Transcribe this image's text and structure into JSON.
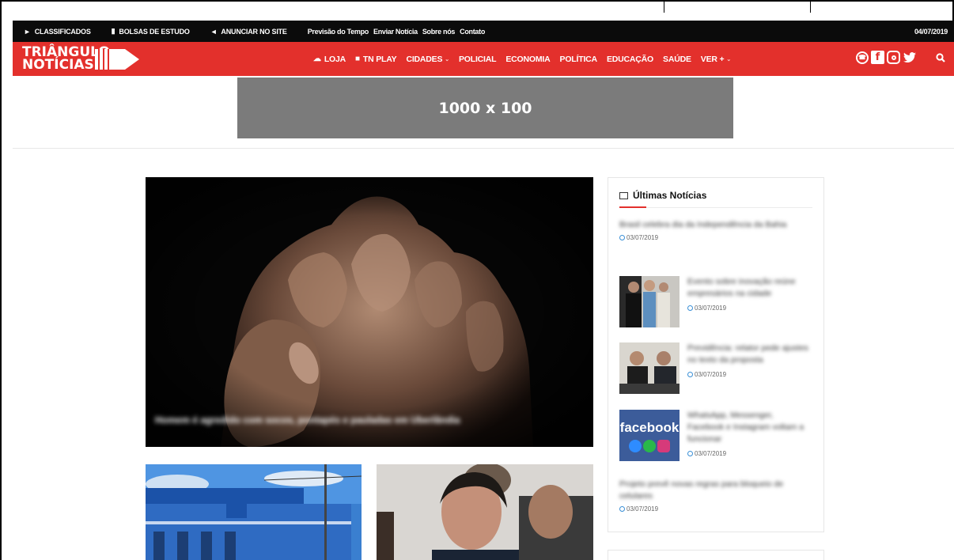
{
  "topbar": {
    "items": [
      {
        "label": "CLASSIFICADOS",
        "icon": "tag-icon"
      },
      {
        "label": "BOLSAS DE ESTUDO",
        "icon": "book-icon"
      },
      {
        "label": "ANUNCIAR NO SITE",
        "icon": "megaphone-icon"
      }
    ],
    "links": [
      "Previsão do Tempo",
      "Enviar Notícia",
      "Sobre nós",
      "Contato"
    ],
    "date": "04/07/2019"
  },
  "nav": {
    "logo_line1": "TRIÂNGULO",
    "logo_line2": "NOTÍCIAS",
    "menu": [
      {
        "label": "LOJA",
        "icon": "shop-icon"
      },
      {
        "label": "TN PLAY",
        "icon": "video-icon"
      },
      {
        "label": "CIDADES",
        "dropdown": true
      },
      {
        "label": "POLICIAL"
      },
      {
        "label": "ECONOMIA"
      },
      {
        "label": "POLÍTICA"
      },
      {
        "label": "EDUCAÇÃO"
      },
      {
        "label": "SAÚDE"
      },
      {
        "label": "VER +",
        "dropdown": true
      }
    ],
    "social": [
      "whatsapp-icon",
      "facebook-icon",
      "instagram-icon",
      "twitter-icon"
    ],
    "brand_color": "#e3302c"
  },
  "ad": {
    "label": "1000 x 100"
  },
  "hero": {
    "caption": "Homem é agredido com socos, pontapés e pauladas em Uberlândia"
  },
  "sidebar": {
    "title": "Últimas Notícias",
    "items": [
      {
        "title": "Brasil celebra dia da Independência da Bahia",
        "date": "03/07/2019"
      },
      {
        "title": "Evento sobre inovação reúne empresários na cidade",
        "date": "03/07/2019"
      },
      {
        "title": "Previdência: relator pede ajustes no texto da proposta",
        "date": "03/07/2019"
      },
      {
        "title": "WhatsApp, Messenger, Facebook e Instagram voltam a funcionar",
        "date": "03/07/2019"
      },
      {
        "title": "Projeto prevê novas regras para bloqueio de celulares",
        "date": "03/07/2019"
      }
    ]
  }
}
